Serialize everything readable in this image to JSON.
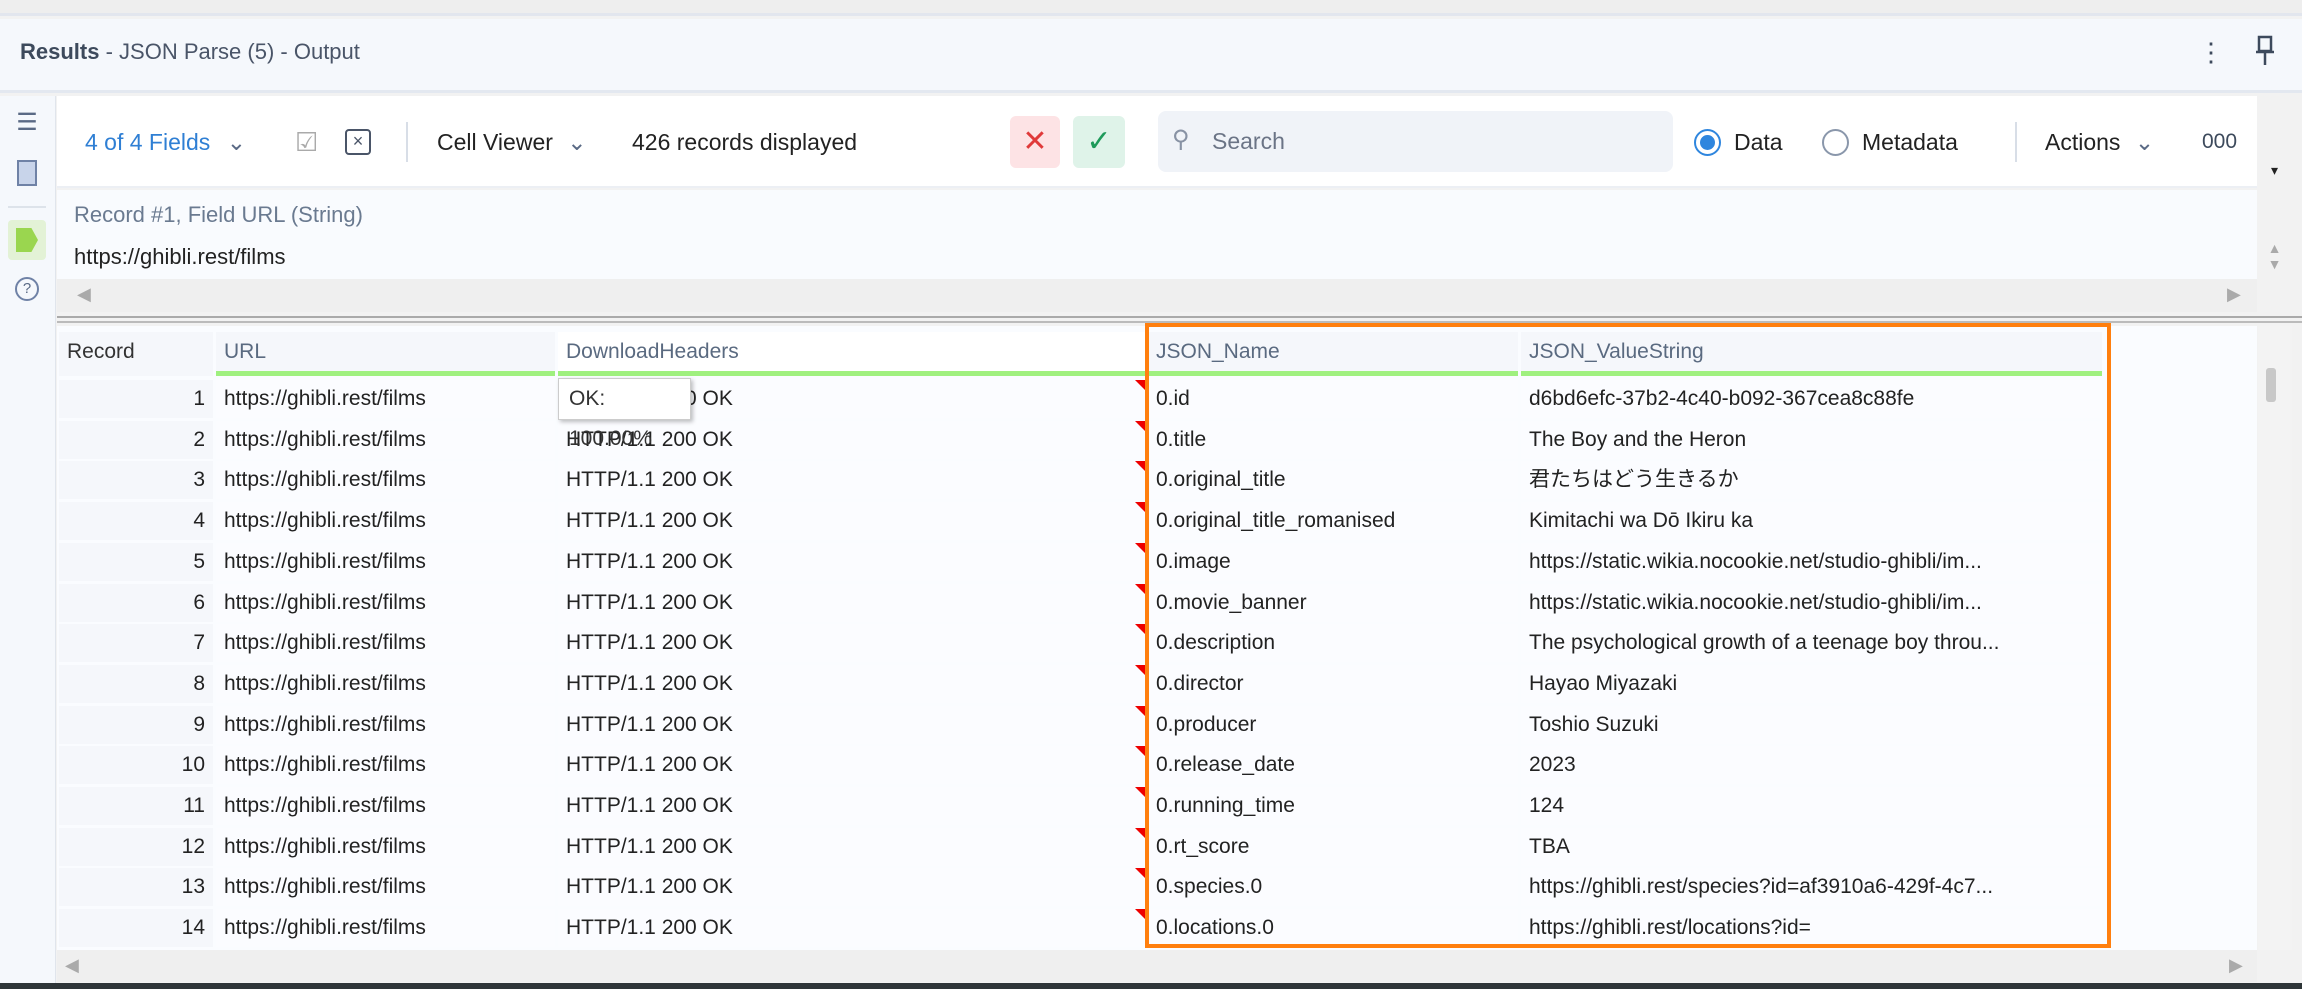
{
  "header": {
    "title_bold": "Results",
    "title_rest": " - JSON Parse (5) - Output",
    "more_icon": "vertical-dots-icon",
    "pin_icon": "pin-icon"
  },
  "sidebar": {
    "icons": [
      "list-icon",
      "bookmark-icon",
      "tag-icon",
      "help-icon"
    ]
  },
  "toolbar": {
    "fields": "4 of 4 Fields",
    "cell_viewer": "Cell Viewer",
    "records": "426 records displayed",
    "search_placeholder": "Search",
    "radio_data": "Data",
    "radio_metadata": "Metadata",
    "selected_view": "Data",
    "actions": "Actions",
    "more": "000",
    "colors": {
      "accent": "#2f86de",
      "cancel": "#e03a3a",
      "confirm": "#1e9a5a"
    }
  },
  "cell_viewer": {
    "label": "Record #1, Field URL (String)",
    "value": "https://ghibli.rest/films"
  },
  "table": {
    "columns": [
      "Record",
      "URL",
      "DownloadHeaders",
      "JSON_Name",
      "JSON_ValueString"
    ],
    "tooltip": "OK: 100.00%",
    "rows": [
      [
        "1",
        "https://ghibli.rest/films",
        "HTTP/1.1 200 OK",
        "0.id",
        "d6bd6efc-37b2-4c40-b092-367cea8c88fe"
      ],
      [
        "2",
        "https://ghibli.rest/films",
        "HTTP/1.1 200 OK",
        "0.title",
        "The Boy and the Heron"
      ],
      [
        "3",
        "https://ghibli.rest/films",
        "HTTP/1.1 200 OK",
        "0.original_title",
        "君たちはどう生きるか"
      ],
      [
        "4",
        "https://ghibli.rest/films",
        "HTTP/1.1 200 OK",
        "0.original_title_romanised",
        "Kimitachi wa Dō Ikiru ka"
      ],
      [
        "5",
        "https://ghibli.rest/films",
        "HTTP/1.1 200 OK",
        "0.image",
        "https://static.wikia.nocookie.net/studio-ghibli/im..."
      ],
      [
        "6",
        "https://ghibli.rest/films",
        "HTTP/1.1 200 OK",
        "0.movie_banner",
        "https://static.wikia.nocookie.net/studio-ghibli/im..."
      ],
      [
        "7",
        "https://ghibli.rest/films",
        "HTTP/1.1 200 OK",
        "0.description",
        "The psychological growth of a teenage boy throu..."
      ],
      [
        "8",
        "https://ghibli.rest/films",
        "HTTP/1.1 200 OK",
        "0.director",
        "Hayao Miyazaki"
      ],
      [
        "9",
        "https://ghibli.rest/films",
        "HTTP/1.1 200 OK",
        "0.producer",
        "Toshio Suzuki"
      ],
      [
        "10",
        "https://ghibli.rest/films",
        "HTTP/1.1 200 OK",
        "0.release_date",
        "2023"
      ],
      [
        "11",
        "https://ghibli.rest/films",
        "HTTP/1.1 200 OK",
        "0.running_time",
        "124"
      ],
      [
        "12",
        "https://ghibli.rest/films",
        "HTTP/1.1 200 OK",
        "0.rt_score",
        "TBA"
      ],
      [
        "13",
        "https://ghibli.rest/films",
        "HTTP/1.1 200 OK",
        "0.species.0",
        "https://ghibli.rest/species?id=af3910a6-429f-4c7..."
      ],
      [
        "14",
        "https://ghibli.rest/films",
        "HTTP/1.1 200 OK",
        "0.locations.0",
        "https://ghibli.rest/locations?id="
      ]
    ],
    "highlight_color": "#ff7f0e"
  }
}
